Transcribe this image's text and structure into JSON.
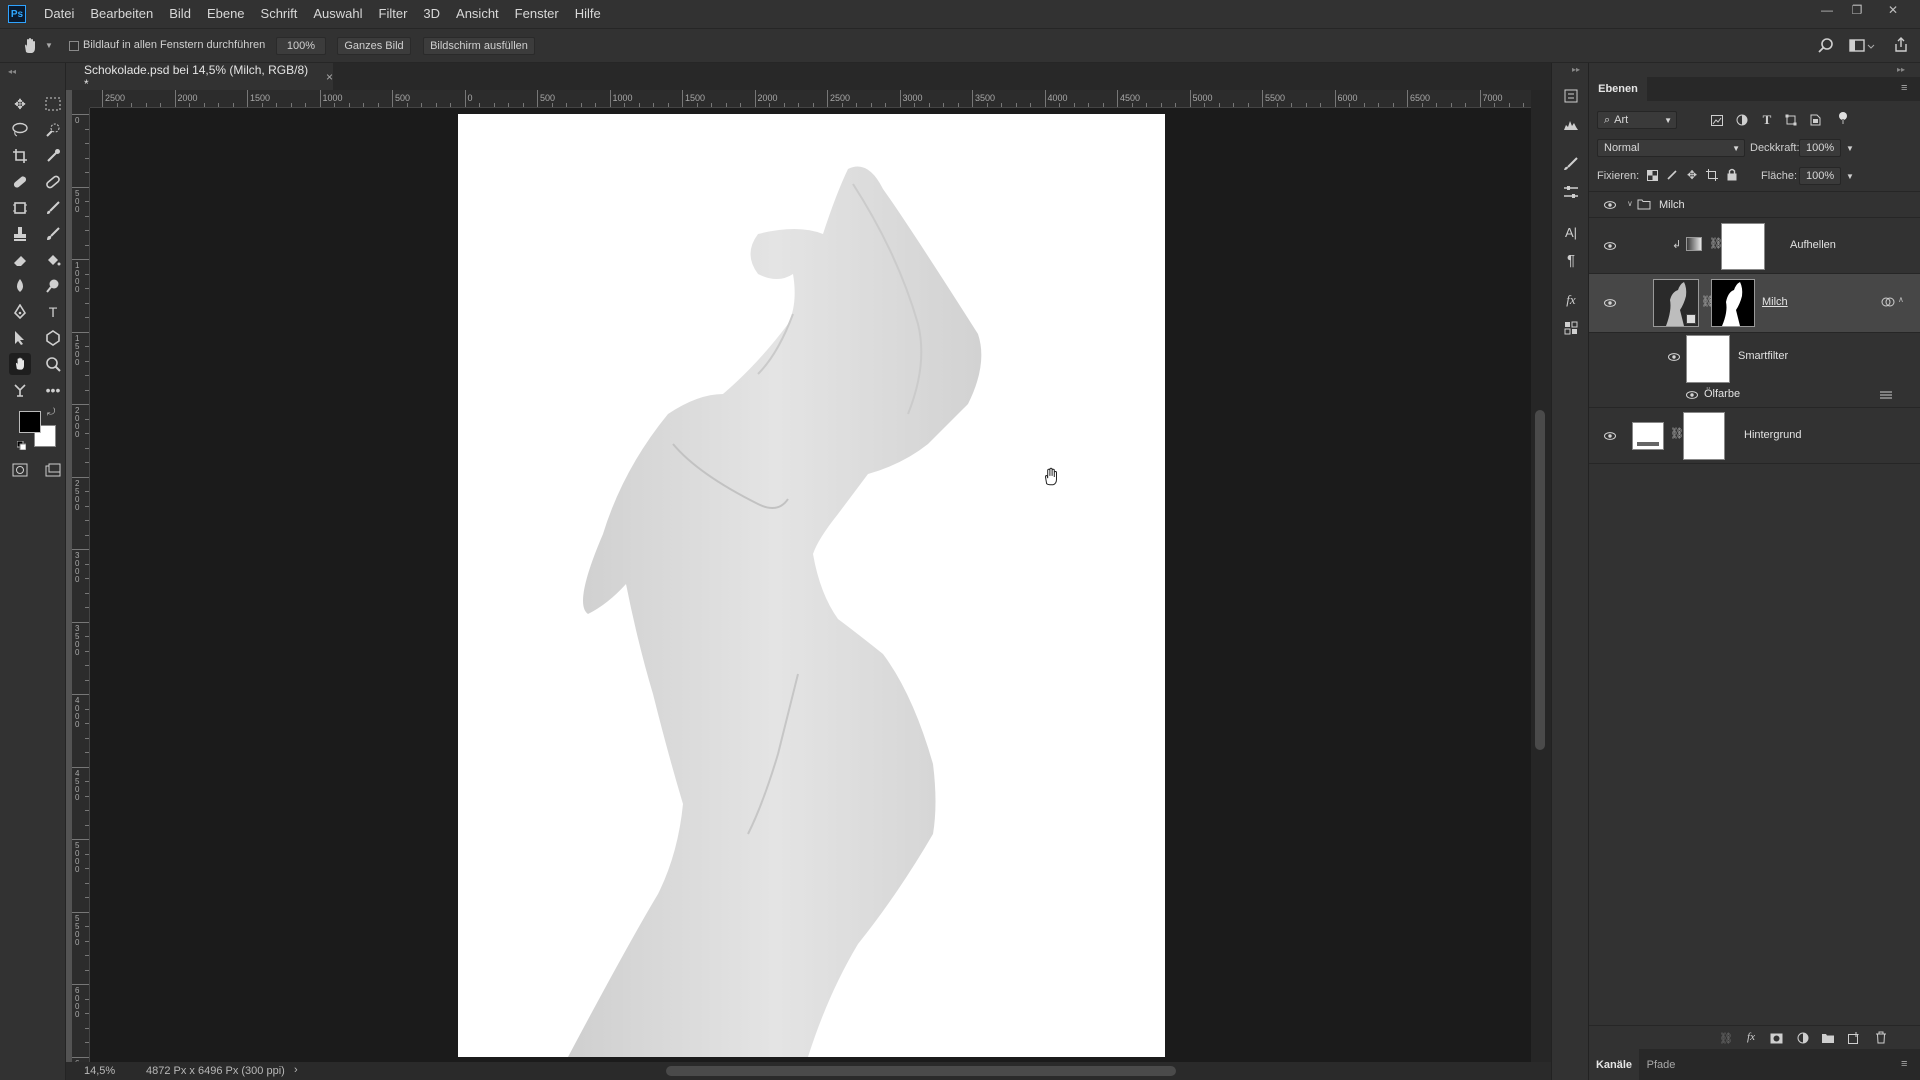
{
  "app": {
    "logo": "Ps"
  },
  "menu": [
    "Datei",
    "Bearbeiten",
    "Bild",
    "Ebene",
    "Schrift",
    "Auswahl",
    "Filter",
    "3D",
    "Ansicht",
    "Fenster",
    "Hilfe"
  ],
  "window_controls": {
    "minimize": "—",
    "restore": "❐",
    "close": "✕"
  },
  "options": {
    "scroll_all_label": "Bildlauf in allen Fenstern durchführen",
    "zoom_value": "100%",
    "fit_screen": "Ganzes Bild",
    "fill_screen": "Bildschirm ausfüllen"
  },
  "document": {
    "tab_title": "Schokolade.psd bei 14,5% (Milch, RGB/8) *",
    "close": "×"
  },
  "ruler": {
    "top_labels": [
      "2500",
      "2000",
      "1500",
      "1000",
      "500",
      "0",
      "500",
      "1000",
      "1500",
      "2000",
      "2500",
      "3000",
      "3500",
      "4000",
      "4500",
      "5000",
      "5500",
      "6000",
      "6500",
      "7000"
    ],
    "left_labels": [
      "0",
      "5\n0\n0",
      "1\n0\n0\n0",
      "1\n5\n0\n0",
      "2\n0\n0\n0",
      "2\n5\n0\n0",
      "3\n0\n0\n0",
      "3\n5\n0\n0",
      "4\n0\n0\n0",
      "4\n5\n0\n0",
      "5\n0\n0\n0",
      "5\n5\n0\n0",
      "6\n0\n0\n0",
      "6\n5\n0\n0"
    ]
  },
  "status": {
    "zoom": "14,5%",
    "size": "4872 Px x 6496 Px (300 ppi)",
    "arrow": "›"
  },
  "layers_panel": {
    "tab": "Ebenen",
    "filter_kind": "Art",
    "blend_mode": "Normal",
    "opacity_label": "Deckkraft:",
    "opacity_value": "100%",
    "lock_label": "Fixieren:",
    "fill_label": "Fläche:",
    "fill_value": "100%",
    "layers": [
      {
        "name": "Milch",
        "type": "group"
      },
      {
        "name": "Aufhellen",
        "type": "adjustment"
      },
      {
        "name": "Milch",
        "type": "smart-object",
        "selected": true
      },
      {
        "name": "Smartfilter",
        "type": "smart-filter"
      },
      {
        "name": "Ölfarbe",
        "type": "filter"
      },
      {
        "name": "Hintergrund",
        "type": "layer"
      }
    ],
    "bottom_tabs": [
      "Kanäle",
      "Pfade"
    ]
  },
  "colors": {
    "foreground": "#000000",
    "background": "#ffffff",
    "accent": "#31a8ff"
  }
}
